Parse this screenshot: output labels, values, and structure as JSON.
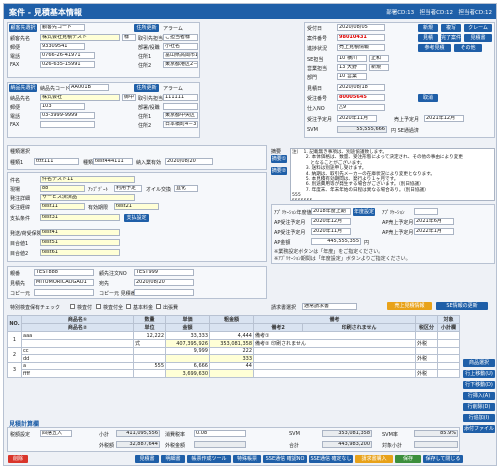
{
  "title": "案件 - 見積基本情報",
  "header_ids": "部署CD:13　担当者CD:12　担当者CD:12",
  "customer": {
    "section": "顧客先選択",
    "name_btn": "顧客先コード",
    "search_btn": "住所更新",
    "alarm": "アラーム",
    "name_label": "顧客先名",
    "name": "株式会社見積テスト",
    "sama": "様",
    "zip_label": "郵便",
    "zip": "93309541",
    "tel_label": "電話",
    "tel": "0766-26-41971",
    "fax_label": "FAX",
    "fax": "026-635-15991",
    "contact_label": "取引先担当者",
    "contact": "ご担当者様",
    "dept_label": "部署/役職",
    "dept": "小社名",
    "addr1_label": "住所1",
    "addr1": "富山県高岡市1",
    "addr2_label": "住所2",
    "addr2": "東京都港区2－2－51"
  },
  "delivery": {
    "section": "納品先選択",
    "code_btn": "納品先コード",
    "code": "AA001B",
    "search_btn": "住所更新",
    "alarm": "アラーム",
    "name_label": "納品先名",
    "name": "株式会社",
    "sama": "御中",
    "zip_label": "郵便",
    "zip": "103",
    "tel_label": "電話",
    "tel": "03-3999-9999",
    "fax_label": "FAX",
    "contact_label": "取引先担当者",
    "contact": "111111",
    "dept_label": "部署/役職",
    "addr1_label": "住所1",
    "addr1": "東京都中央区",
    "addr2_label": "住所2",
    "addr2": "日本橋町4－3－16"
  },
  "order": {
    "recv_label": "受付日",
    "recv": "2020/08/05",
    "btn_new": "新規",
    "btn_copy": "複写",
    "btn_claim": "クレーム",
    "no_label": "案件番号",
    "no": "98010431",
    "btn_copy2": "見積",
    "btn_done": "完了案件",
    "btn_pdf": "見積書",
    "status_label": "進捗状況",
    "status": "売上見積情報",
    "btn_ref": "参考見積",
    "btn_other": "その他",
    "dept_label": "SE担当",
    "dept": "10 横川",
    "dept2": "正和",
    "sales_label": "営業担当",
    "sales": "13 大野",
    "sales2": "新規",
    "section_label": "部門",
    "section": "10 営業",
    "est_label": "見積日",
    "est": "2020/08/18",
    "order_no_label": "受注番号",
    "order_no": "80005645",
    "btn_cancel": "取消",
    "vendor_label": "仕入NO",
    "vendor": "△9",
    "order_date_label": "受注予定月",
    "order_date": "2020年11月",
    "sale_label": "売上予定月",
    "sale": "2021年12月",
    "svm_label": "SVM",
    "svm": "55,555,666",
    "svm_note": "円 SE通過済"
  },
  "info": {
    "kind_label": "種類選択",
    "kind_sub": "種類1",
    "kind1": "tttt111",
    "kind2_label": "種類",
    "kind2": "test444111",
    "kind3_label": "納入業有効",
    "kind3": "2020/08/20"
  },
  "project": {
    "name_label": "件名",
    "name": "件名テスト11",
    "site_label": "現場",
    "site": "88",
    "type_label": "ｱｯﾌﾟﾃﾞｰﾄ",
    "type": "利用予定",
    "opt_label": "オイル交換",
    "opt": "直化",
    "detail_label": "発注詳細",
    "detail": "サービス済済品",
    "contract_label": "受注経緯",
    "contract": "test11",
    "period_label": "有効期限",
    "period": "test21",
    "pay_label": "支払条件",
    "pay": "test31",
    "pay_btn": "支払設定",
    "trans_label": "発送/荷受保険",
    "trans": "test41",
    "misc1_label": "目合値1",
    "misc1": "test51",
    "misc2_label": "目合値2",
    "misc2": "test61"
  },
  "memo": {
    "label": "摘要",
    "btn1": "摘要①",
    "btn2": "摘要②",
    "text": "注）　1. 記載無き事項は、別途協議致します。\n　　　2. 本体価格は、数量、受注形態によって決定され、その他の事由により変更\n　　　　となることがございます。\n　　　3. 送料は別途申し受けます。\n　　　4. 納期は、取引先メーカーの在庫状況により変更となります。\n　　　5. 本見積有効期間は、発行より１ヶ月です。\n　　　6. 別途費用等が発生する場合がございます。（別日協議）\n　　　7. 年度末、年末年始の日程は異なる場合あり。（別日協議）\n555\n5555555\ntest1"
  },
  "fiscal": {
    "year_label": "ｱﾌﾟﾘｹｰｼｮﾝ年度値",
    "year": "2018年度上期",
    "year_btn": "年度設定",
    "ap_label": "ｱﾌﾟﾘｹｰｼｮﾝ",
    "ap_order_label": "AP受注予定月",
    "ap_order": "2020年12月",
    "ap_sale_label": "AP売上予定月",
    "ap_sale": "2021年6月",
    "ap_delivery_label": "AP受注予定月",
    "ap_delivery": "2020年11月",
    "ap_sale2_label": "AP売上予定月",
    "ap_sale2": "2022年1月",
    "ap_amount_label": "AP金額",
    "ap_amount": "445,555,355",
    "ap_unit": "円",
    "note1": "※業務設定ボタンは「年度」をご指定ください。",
    "note2": "※ｱﾌﾟﾘｹｰｼｮﾝ期間は「年度設定」ボタンよりご指定ください。"
  },
  "misc": {
    "group_label": "親番",
    "group": "TEST888",
    "customer_no_label": "顧先注文NO",
    "customer_no": "TEST999",
    "ref_label": "見積先",
    "ref": "MITUMORICAOGAO1",
    "dest_label": "宛先",
    "dest": "2020/08/20",
    "copy_label": "コピー元",
    "copy_val": "",
    "copy2_label": "コピー元 見積番号",
    "copy2_val": ""
  },
  "checks": {
    "label": "特別検査保有チェック",
    "c1": "検査付",
    "c2": "検査付全",
    "c3": "基本料金",
    "c4": "出張費"
  },
  "approval": {
    "label": "請求書選択",
    "value": "通常請求書",
    "btn1": "売上見積情報",
    "btn2": "SE情報の更新"
  },
  "table": {
    "headers": [
      "NO.",
      "商品名①",
      "数量",
      "単価",
      "粗金額",
      "備考",
      "対象"
    ],
    "headers2": [
      "商品名②",
      "単位",
      "金額",
      "備考2",
      "印刷されません",
      "税区分",
      "小計欄"
    ],
    "rows": [
      {
        "no": "1",
        "n1": "aaa",
        "n2": "",
        "qty": "12,222",
        "unit": "式",
        "price": "33,333",
        "cost": "407,395,926",
        "amt": "4,444",
        "gross": "353,081,358",
        "note": "備考①",
        "note2": "備考② 印刷されません",
        "tax": "外税"
      },
      {
        "no": "2",
        "n1": "cc",
        "n2": "dd",
        "qty": "",
        "unit": "",
        "price": "9,999",
        "cost": "",
        "amt": "222",
        "gross": "333",
        "note": "",
        "note2": "",
        "tax": "外税"
      },
      {
        "no": "3",
        "n1": "a",
        "n2": "ffff",
        "qty": "555",
        "unit": "",
        "price": "6,666",
        "cost": "3,699,630",
        "amt": "44",
        "gross": "",
        "note": "",
        "note2": "",
        "tax": "外税"
      }
    ]
  },
  "side_buttons": [
    "商品選択",
    "行上移動(U)",
    "行下移動(D)",
    "行挿入(A)",
    "行削除(D)",
    "行追加(I)",
    "添付ファイル"
  ],
  "totals": {
    "section": "見積計算欄",
    "tax_label": "税額設定",
    "tax": "四捨五入",
    "subtotal_label": "小計",
    "subtotal": "411,095,556",
    "taxrate_label": "消費税率",
    "taxrate": "0.08",
    "svm_label": "SVM",
    "svm": "353,081,358",
    "svmr_label": "SVM率",
    "svmr": "85.9%",
    "excl_label": "外税額",
    "excl": "32,887,644",
    "tax2_label": "外税金額",
    "tax2": "",
    "total_label": "合計",
    "total": "443,983,200",
    "target_label": "対象小計",
    "target": ""
  },
  "footer": {
    "btn_delete": "削除",
    "buttons": [
      "見積書",
      "明細書",
      "帳票作成ツール",
      "特殊帳票",
      "SSE通信 確認NO",
      "SSE通信 確定なし",
      "請求書購入",
      "保存",
      "保存して閉じる"
    ]
  },
  "colors": {
    "primary": "#1f5fa8",
    "danger": "#d9352b",
    "warning": "#e8a21a",
    "highlight": "#ffffd6"
  }
}
